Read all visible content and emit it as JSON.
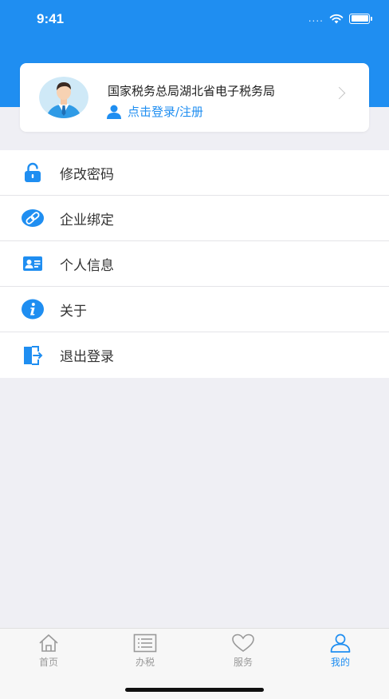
{
  "status_bar": {
    "time": "9:41",
    "signal": "....",
    "icons": [
      "wifi-icon",
      "battery-icon"
    ]
  },
  "profile": {
    "title": "国家税务总局湖北省电子税务局",
    "login_label": "点击登录/注册",
    "avatar": "avatar",
    "chevron": "chevron-right-icon"
  },
  "menu": [
    {
      "label": "修改密码",
      "icon": "lock-icon"
    },
    {
      "label": "企业绑定",
      "icon": "link-icon"
    },
    {
      "label": "个人信息",
      "icon": "id-card-icon"
    },
    {
      "label": "关于",
      "icon": "info-icon"
    },
    {
      "label": "退出登录",
      "icon": "logout-icon"
    }
  ],
  "tabbar": [
    {
      "label": "首页",
      "icon": "home-icon",
      "active": false
    },
    {
      "label": "办税",
      "icon": "list-icon",
      "active": false
    },
    {
      "label": "服务",
      "icon": "heart-icon",
      "active": false
    },
    {
      "label": "我的",
      "icon": "user-icon",
      "active": true
    }
  ],
  "colors": {
    "primary": "#1f8ef1",
    "background": "#efeff4",
    "card": "#ffffff",
    "inactive": "#999999"
  }
}
